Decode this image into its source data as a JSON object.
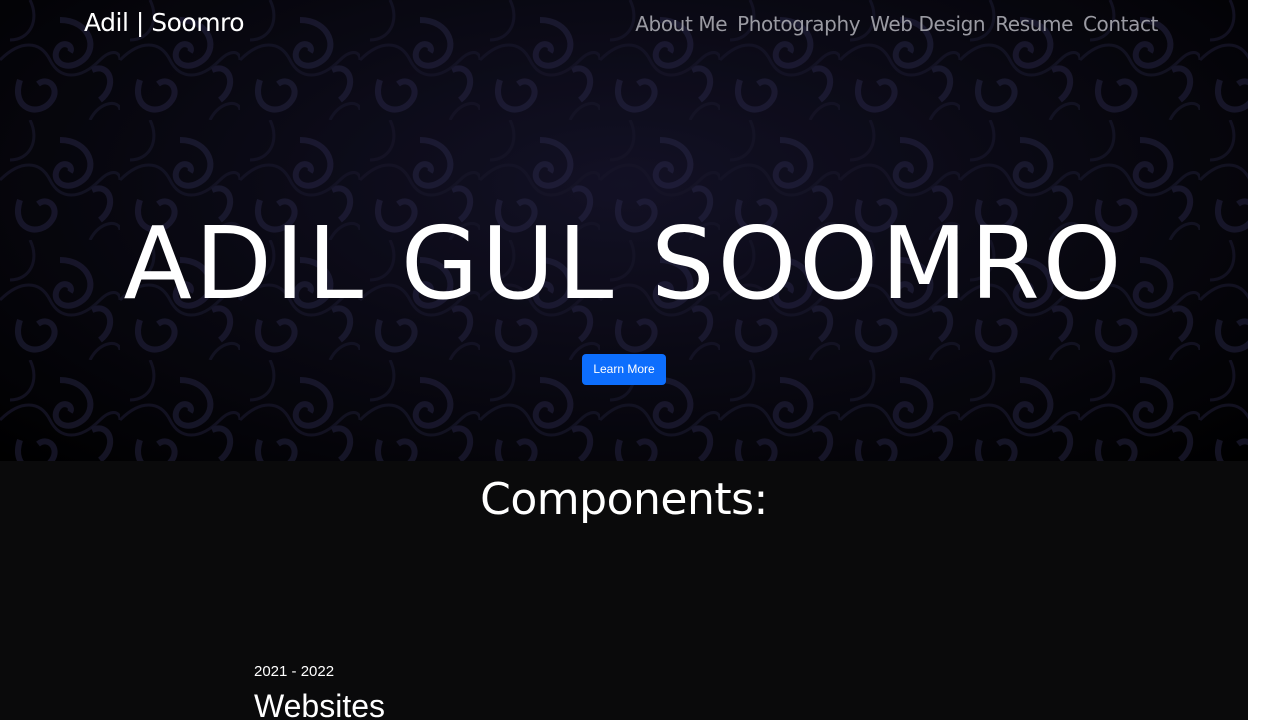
{
  "header": {
    "brand": "Adil | Soomro",
    "nav": [
      "About Me",
      "Photography",
      "Web Design",
      "Resume",
      "Contact"
    ]
  },
  "hero": {
    "title": "ADIL GUL SOOMRO",
    "button_label": "Learn More"
  },
  "components": {
    "heading": "Components:",
    "items": [
      {
        "date": "2021 - 2022",
        "title": "Websites"
      }
    ]
  },
  "colors": {
    "accent": "#0d6efd",
    "page_background": "#0a0a0b",
    "nav_text": "#9a9aa2"
  }
}
